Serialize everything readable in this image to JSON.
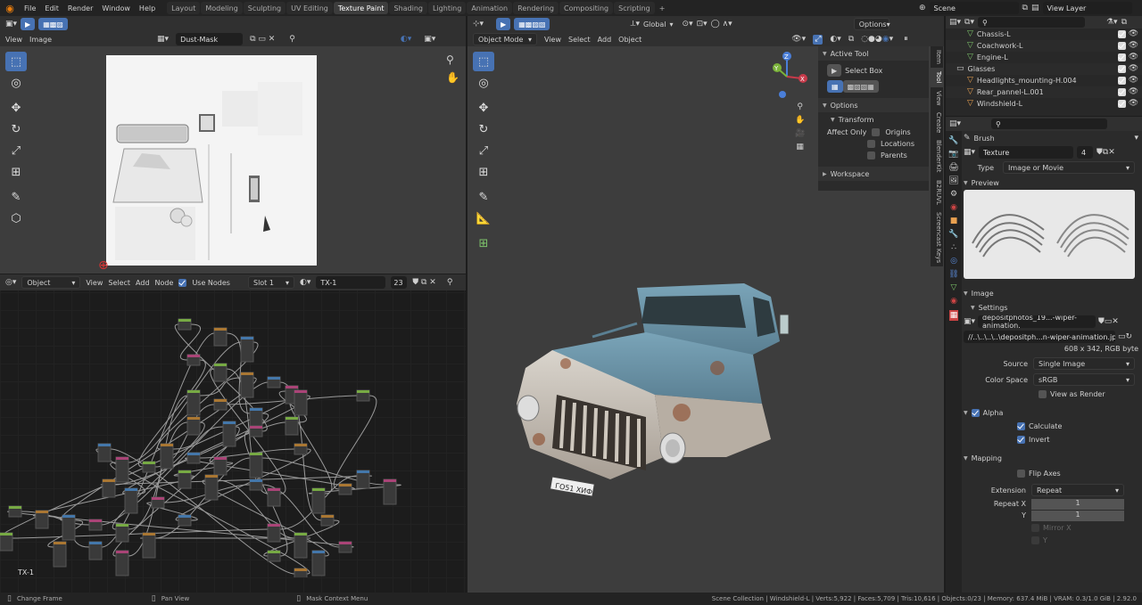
{
  "topbar": {
    "menus": [
      "File",
      "Edit",
      "Render",
      "Window",
      "Help"
    ],
    "workspaces": [
      "Layout",
      "Modeling",
      "Sculpting",
      "UV Editing",
      "Texture Paint",
      "Shading",
      "Lighting",
      "Animation",
      "Rendering",
      "Compositing",
      "Scripting"
    ],
    "active_workspace": "Texture Paint",
    "scene": "Scene",
    "view_layer": "View Layer",
    "add_tab": "+"
  },
  "image_editor": {
    "menus": [
      "View",
      "Image"
    ],
    "image_name": "Dust-Mask"
  },
  "node_editor": {
    "mode": "Object",
    "menus": [
      "View",
      "Select",
      "Add",
      "Node"
    ],
    "use_nodes_label": "Use Nodes",
    "slot": "Slot 1",
    "material": "TX-1",
    "users": "23",
    "frame_label": "TX-1"
  },
  "viewport": {
    "mode": "Object Mode",
    "menus": [
      "View",
      "Select",
      "Add",
      "Object"
    ],
    "transform": "Global",
    "options": "Options",
    "axes": {
      "x": "X",
      "y": "Y",
      "z": "Z"
    }
  },
  "tool_panel": {
    "active_tool_title": "Active Tool",
    "tool_name": "Select Box",
    "options_title": "Options",
    "transform_title": "Transform",
    "affect_only": "Affect Only",
    "origins": "Origins",
    "locations": "Locations",
    "parents": "Parents",
    "workspace": "Workspace"
  },
  "sidebar_tabs": [
    "Item",
    "Tool",
    "View",
    "Create",
    "BlenderKit",
    "B2RUVL",
    "Screencast Keys"
  ],
  "outliner": {
    "search_placeholder": "",
    "items": [
      {
        "name": "Chassis-L",
        "sub": "2",
        "indent": 2,
        "type": "mesh",
        "color": "#7ec46b"
      },
      {
        "name": "Coachwork-L",
        "sub": "",
        "indent": 2,
        "type": "mesh",
        "color": "#7ec46b"
      },
      {
        "name": "Engine-L",
        "sub": "",
        "indent": 2,
        "type": "mesh",
        "color": "#7ec46b"
      },
      {
        "name": "Glasses",
        "sub": "",
        "indent": 1,
        "type": "collection",
        "color": "#cccccc"
      },
      {
        "name": "Headlights_mounting-H.004",
        "sub": "",
        "indent": 2,
        "type": "mesh",
        "color": "#e8a050"
      },
      {
        "name": "Rear_pannel-L.001",
        "sub": "",
        "indent": 2,
        "type": "mesh",
        "color": "#e8a050"
      },
      {
        "name": "Windshield-L",
        "sub": "",
        "indent": 2,
        "type": "mesh",
        "color": "#e8a050"
      }
    ]
  },
  "properties": {
    "brush_label": "Brush",
    "texture_name": "Texture",
    "texture_users": "4",
    "type_label": "Type",
    "type_value": "Image or Movie",
    "preview_label": "Preview",
    "image_label": "Image",
    "settings_label": "Settings",
    "image_file": "depositphotos_19...-wiper-animation.",
    "filepath": "//..\\..\\..\\..\\depositph...n-wiper-animation.jpg",
    "image_info": "608 x 342,  RGB byte",
    "source_label": "Source",
    "source_value": "Single Image",
    "color_space_label": "Color Space",
    "color_space_value": "sRGB",
    "view_as_render": "View as Render",
    "alpha_label": "Alpha",
    "calculate": "Calculate",
    "invert": "Invert",
    "mapping_label": "Mapping",
    "flip_axes": "Flip Axes",
    "extension_label": "Extension",
    "extension_value": "Repeat",
    "repeat_x_label": "Repeat X",
    "repeat_x": "1",
    "repeat_y_label": "Y",
    "repeat_y": "1",
    "mirror_x": "Mirror X",
    "mirror_y": "Y"
  },
  "statusbar": {
    "change_frame": "Change Frame",
    "pan_view": "Pan View",
    "mask_menu": "Mask Context Menu",
    "stats": "Scene Collection | Windshield-L | Verts:5,922 | Faces:5,709 | Tris:10,616 | Objects:0/23 | Memory: 637.4 MiB | VRAM: 0.3/1.0 GiB | 2.92.0"
  },
  "plate_text": "ГО51 ХИФ",
  "colors": {
    "accent": "#4772b3",
    "header": "#303030",
    "panel": "#3d3d3d",
    "viewport_bg": "#3d3d3d"
  }
}
